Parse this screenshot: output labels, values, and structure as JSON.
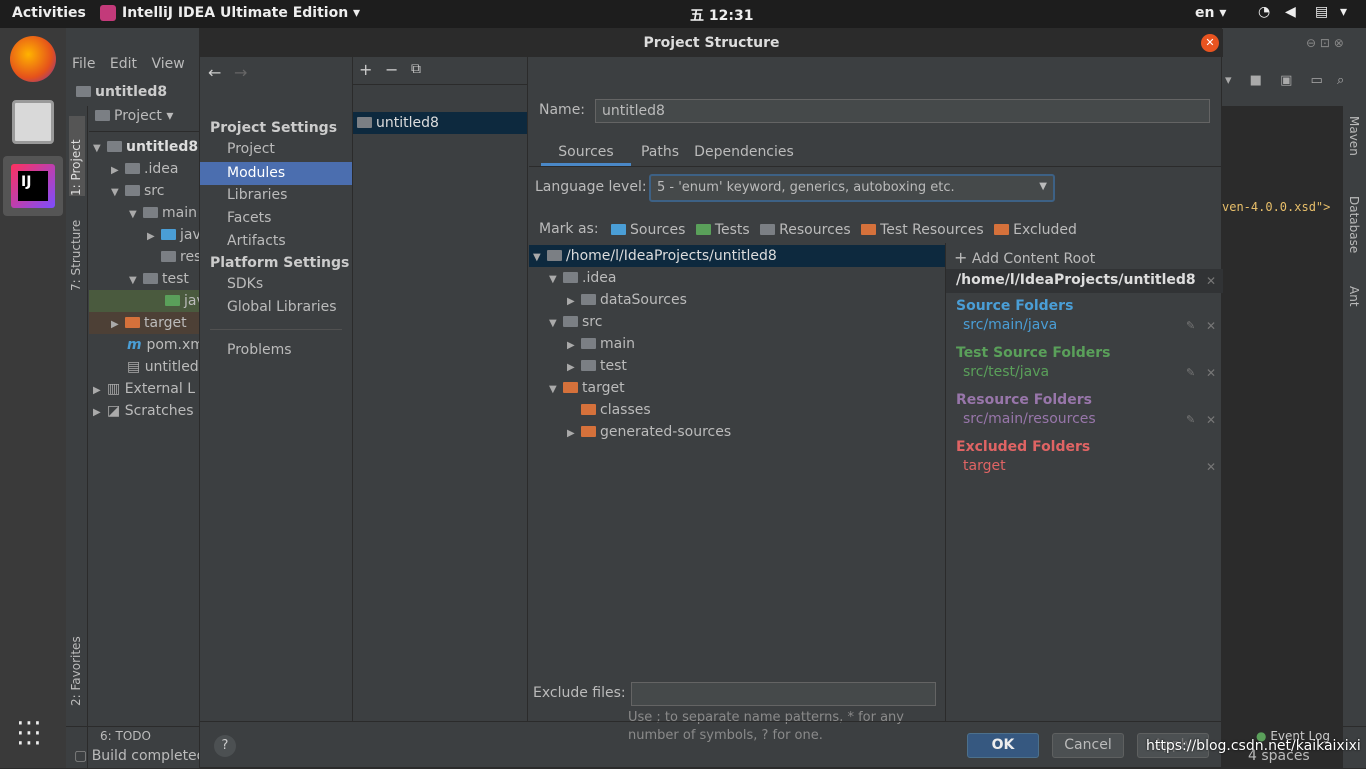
{
  "topbar": {
    "activities": "Activities",
    "app_name": "IntelliJ IDEA Ultimate Edition",
    "clock": "五 12:31",
    "lang": "en"
  },
  "ide": {
    "menu": [
      "File",
      "Edit",
      "View"
    ],
    "project_name": "untitled8",
    "project_view_label": "Project",
    "tree": [
      ".idea",
      "src",
      "main",
      "jav",
      "res",
      "test",
      "jav",
      "target",
      "pom.xm",
      "untitled",
      "External L",
      "Scratches"
    ],
    "tree_root": "untitled8",
    "left_tabs": [
      "1: Project",
      "7: Structure",
      "2: Favorites"
    ],
    "right_tabs": [
      "Maven",
      "Database",
      "Ant"
    ],
    "editor_snippet": "ven-4.0.0.xsd\">",
    "bottom_tabs": [
      "6: TODO"
    ],
    "status": "Build completed",
    "event_log": "Event Log",
    "spaces": "4 spaces",
    "url": "https://blog.csdn.net/kaikaixixi"
  },
  "dialog": {
    "title": "Project Structure",
    "nav": {
      "project_settings_header": "Project Settings",
      "project_settings": [
        "Project",
        "Modules",
        "Libraries",
        "Facets",
        "Artifacts"
      ],
      "platform_settings_header": "Platform Settings",
      "platform_settings": [
        "SDKs",
        "Global Libraries"
      ],
      "problems": "Problems"
    },
    "module_list": [
      "untitled8"
    ],
    "name_label": "Name:",
    "name_value": "untitled8",
    "tabs": [
      "Sources",
      "Paths",
      "Dependencies"
    ],
    "active_tab": "Sources",
    "language_level_label": "Language level:",
    "language_level_value": "5 - 'enum' keyword, generics, autoboxing etc.",
    "mark_as_label": "Mark as:",
    "mark_as": [
      "Sources",
      "Tests",
      "Resources",
      "Test Resources",
      "Excluded"
    ],
    "tree_root": "/home/l/IdeaProjects/untitled8",
    "tree": [
      ".idea",
      "dataSources",
      "src",
      "main",
      "test",
      "target",
      "classes",
      "generated-sources"
    ],
    "add_content_root": "Add Content Root",
    "content_root_path": "/home/l/IdeaProjects/untitled8",
    "source_folders_label": "Source Folders",
    "source_folder": "src/main/java",
    "test_source_folders_label": "Test Source Folders",
    "test_source_folder": "src/test/java",
    "resource_folders_label": "Resource Folders",
    "resource_folder": "src/main/resources",
    "excluded_folders_label": "Excluded Folders",
    "excluded_folder": "target",
    "exclude_files_label": "Exclude files:",
    "exclude_hint": "Use ; to separate name patterns, * for any number of symbols, ? for one.",
    "ok": "OK",
    "cancel": "Cancel",
    "apply": "Apply",
    "help": "?"
  },
  "colors": {
    "accent": "#4b6eaf",
    "source": "#4a9ed6",
    "test": "#5aa05a",
    "resource": "#9876aa",
    "excluded": "#e06464"
  }
}
